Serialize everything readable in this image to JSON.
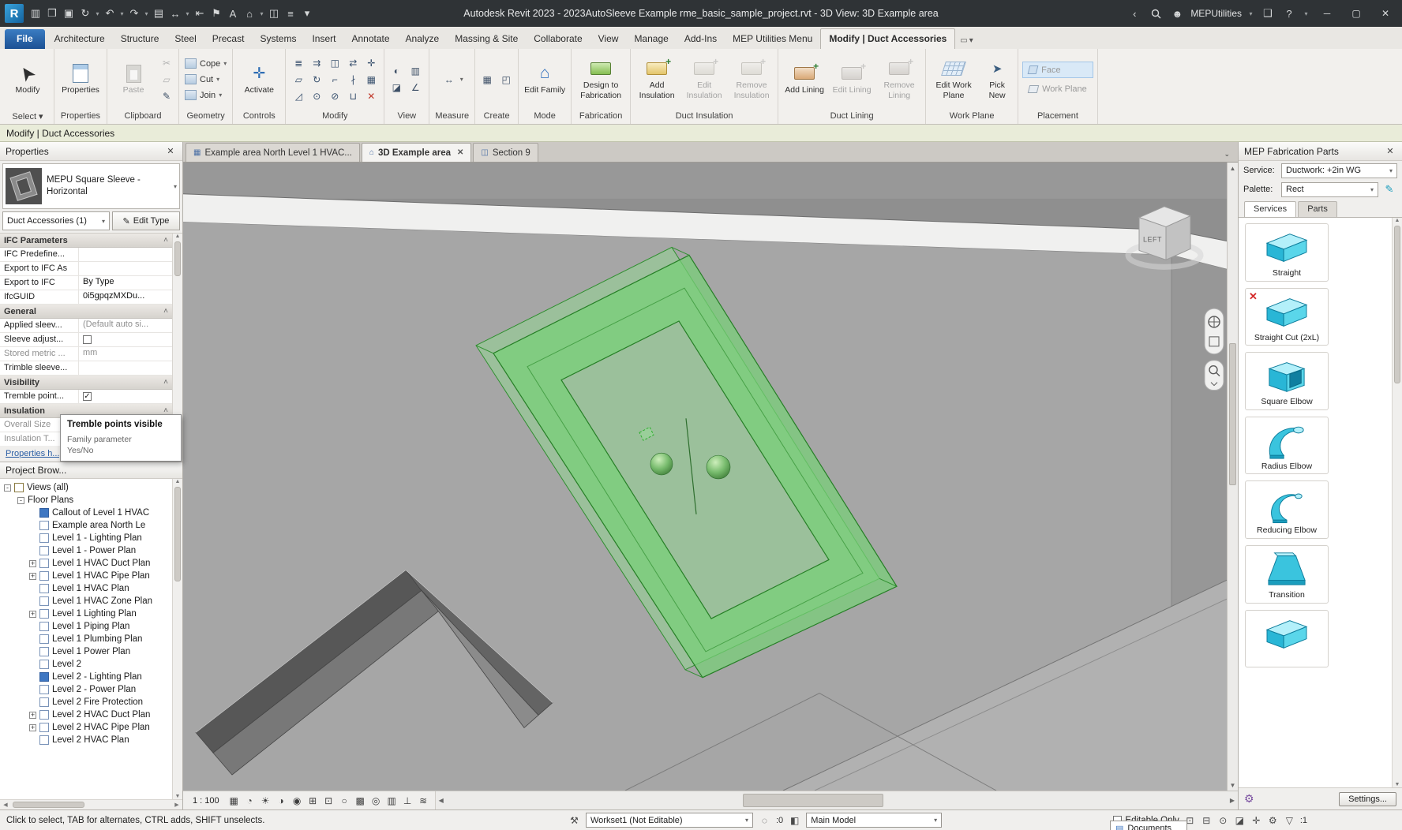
{
  "title_bar": {
    "title": "Autodesk Revit 2023 - 2023AutoSleeve Example rme_basic_sample_project.rvt - 3D View: 3D Example area",
    "account": "MEPUtilities",
    "qat": [
      {
        "name": "revit-logo",
        "glyph": "R",
        "logo": true
      },
      {
        "name": "file-tabs-icon",
        "glyph": "▥"
      },
      {
        "name": "open-icon",
        "glyph": "❒"
      },
      {
        "name": "save-icon",
        "glyph": "▣"
      },
      {
        "name": "sync-with-central-icon",
        "glyph": "↻",
        "caret": true
      },
      {
        "name": "undo-icon",
        "glyph": "↶",
        "caret": true
      },
      {
        "name": "redo-icon",
        "glyph": "↷",
        "caret": true
      },
      {
        "name": "print-icon",
        "glyph": "▤"
      },
      {
        "name": "measure-icon",
        "glyph": "↔",
        "caret": true
      },
      {
        "name": "aligned-dimension-icon",
        "glyph": "⇤"
      },
      {
        "name": "tag-by-category-icon",
        "glyph": "⚑"
      },
      {
        "name": "text-icon",
        "glyph": "A"
      },
      {
        "name": "default-3d-view-icon",
        "glyph": "⌂",
        "caret": true
      },
      {
        "name": "section-icon",
        "glyph": "◫"
      },
      {
        "name": "thin-lines-icon",
        "glyph": "≡"
      },
      {
        "name": "customize-qat-icon",
        "glyph": "▾"
      }
    ],
    "help_label": "?"
  },
  "ribbon_tabs": {
    "items": [
      {
        "label": "File",
        "file": true
      },
      {
        "label": "Architecture"
      },
      {
        "label": "Structure"
      },
      {
        "label": "Steel"
      },
      {
        "label": "Precast"
      },
      {
        "label": "Systems"
      },
      {
        "label": "Insert"
      },
      {
        "label": "Annotate"
      },
      {
        "label": "Analyze"
      },
      {
        "label": "Massing & Site"
      },
      {
        "label": "Collaborate"
      },
      {
        "label": "View"
      },
      {
        "label": "Manage"
      },
      {
        "label": "Add-Ins"
      },
      {
        "label": "MEP Utilities Menu"
      },
      {
        "label": "Modify | Duct Accessories",
        "active": true
      }
    ]
  },
  "ribbon": {
    "select": {
      "modify": "Modify",
      "panel": "Select ▾"
    },
    "properties": {
      "button": "Properties",
      "panel": "Properties"
    },
    "clipboard": {
      "paste": "Paste",
      "panel": "Clipboard",
      "small_icons": [
        {
          "name": "cut-icon",
          "glyph": "✂",
          "disabled": true
        },
        {
          "name": "copy-to-clipboard-icon",
          "glyph": "▱",
          "disabled": true
        },
        {
          "name": "match-type-properties-icon",
          "glyph": "✎"
        }
      ]
    },
    "geometry": {
      "rows": [
        "Cope",
        "Cut",
        "Join"
      ],
      "panel": "Geometry"
    },
    "controls": {
      "activate": "Activate",
      "panel": "Controls"
    },
    "modify": {
      "panel": "Modify",
      "icons": [
        {
          "name": "align-icon",
          "glyph": "≣"
        },
        {
          "name": "offset-icon",
          "glyph": "⇉"
        },
        {
          "name": "mirror-axis-icon",
          "glyph": "◫"
        },
        {
          "name": "mirror-pick-icon",
          "glyph": "⇄"
        },
        {
          "name": "move-icon",
          "glyph": "✛"
        },
        {
          "name": "copy-icon",
          "glyph": "▱"
        },
        {
          "name": "rotate-icon",
          "glyph": "↻"
        },
        {
          "name": "trim-extend-icon",
          "glyph": "⌐"
        },
        {
          "name": "split-icon",
          "glyph": "∤"
        },
        {
          "name": "array-icon",
          "glyph": "▦"
        },
        {
          "name": "scale-icon",
          "glyph": "◿"
        },
        {
          "name": "pin-icon",
          "glyph": "⊙"
        },
        {
          "name": "unpin-icon",
          "glyph": "⊘"
        },
        {
          "name": "join-geometry-icon",
          "glyph": "⊔"
        },
        {
          "name": "delete-icon",
          "glyph": "✕",
          "color": "#c0392b"
        }
      ]
    },
    "view": {
      "panel": "View",
      "icons": [
        {
          "name": "hide-elements-icon",
          "glyph": "◐"
        },
        {
          "name": "override-graphics-icon",
          "glyph": "▥"
        },
        {
          "name": "displace-elements-icon",
          "glyph": "◪"
        },
        {
          "name": "linework-icon",
          "glyph": "∠"
        }
      ]
    },
    "measure": {
      "panel": "Measure",
      "icons": [
        {
          "name": "measure-distance-icon",
          "glyph": "↔"
        }
      ]
    },
    "create": {
      "panel": "Create",
      "icons": [
        {
          "name": "create-parts-icon",
          "glyph": "▦"
        },
        {
          "name": "create-assembly-icon",
          "glyph": "◰"
        }
      ]
    },
    "mode": {
      "edit_family": "Edit Family",
      "panel": "Mode"
    },
    "fabrication": {
      "design_to_fab": "Design to Fabrication",
      "panel": "Fabrication"
    },
    "duct_insulation": {
      "add": "Add Insulation",
      "edit": "Edit Insulation",
      "remove": "Remove Insulation",
      "panel": "Duct Insulation"
    },
    "duct_lining": {
      "add": "Add Lining",
      "edit": "Edit Lining",
      "remove": "Remove Lining",
      "panel": "Duct Lining"
    },
    "work_plane": {
      "edit": "Edit Work Plane",
      "pick": "Pick New",
      "panel": "Work Plane"
    },
    "placement": {
      "face": "Face",
      "work_plane": "Work Plane",
      "panel": "Placement"
    }
  },
  "options_bar": {
    "text": "Modify | Duct Accessories"
  },
  "properties": {
    "header": "Properties",
    "type_name": "MEPU Square Sleeve - Horizontal",
    "selector": "Duct Accessories (1)",
    "edit_type": "Edit Type",
    "help_link": "Properties h...",
    "tooltip": {
      "title": "Tremble points visible",
      "line1": "Family parameter",
      "line2": "Yes/No"
    },
    "sections": [
      {
        "name": "IFC Parameters",
        "rows": [
          {
            "label": "IFC Predefine...",
            "value": "",
            "type": "text"
          },
          {
            "label": "Export to IFC As",
            "value": "",
            "type": "text"
          },
          {
            "label": "Export to IFC",
            "value": "By Type",
            "type": "text"
          },
          {
            "label": "IfcGUID",
            "value": "0i5gpqzMXDu...",
            "type": "text"
          }
        ]
      },
      {
        "name": "General",
        "rows": [
          {
            "label": "Applied sleev...",
            "value": "(Default auto si...",
            "type": "text",
            "value_muted": true
          },
          {
            "label": "Sleeve adjust...",
            "value": "",
            "type": "checkbox",
            "checked": false
          },
          {
            "label": "Stored metric ...",
            "value": "mm",
            "type": "text",
            "label_muted": true,
            "value_muted": true
          },
          {
            "label": "Trimble sleeve...",
            "value": "",
            "type": "text"
          }
        ]
      },
      {
        "name": "Visibility",
        "rows": [
          {
            "label": "Tremble point...",
            "value": "",
            "type": "checkbox",
            "checked": true
          }
        ]
      },
      {
        "name": "Insulation",
        "rows": [
          {
            "label": "Overall Size",
            "value": "",
            "type": "text",
            "label_muted": true
          },
          {
            "label": "Insulation T...",
            "value": "",
            "type": "text",
            "label_muted": true
          }
        ]
      }
    ]
  },
  "project_browser": {
    "header": "Project Brow...",
    "root_label": "Views (all)",
    "group_label": "Floor Plans",
    "items": [
      {
        "label": "Callout of Level 1 HVAC",
        "highlight": true
      },
      {
        "label": "Example area North Le"
      },
      {
        "label": "Level 1 - Lighting Plan"
      },
      {
        "label": "Level 1 - Power Plan"
      },
      {
        "label": "Level 1 HVAC Duct Plan",
        "expandable": true
      },
      {
        "label": "Level 1 HVAC Pipe Plan",
        "expandable": true
      },
      {
        "label": "Level 1 HVAC Plan"
      },
      {
        "label": "Level 1 HVAC Zone Plan"
      },
      {
        "label": "Level 1 Lighting Plan",
        "expandable": true
      },
      {
        "label": "Level 1 Piping Plan"
      },
      {
        "label": "Level 1 Plumbing Plan"
      },
      {
        "label": "Level 1 Power Plan"
      },
      {
        "label": "Level 2"
      },
      {
        "label": "Level 2 - Lighting Plan",
        "highlight": true
      },
      {
        "label": "Level 2 - Power Plan"
      },
      {
        "label": "Level 2 Fire Protection"
      },
      {
        "label": "Level 2 HVAC Duct Plan",
        "expandable": true
      },
      {
        "label": "Level 2 HVAC Pipe Plan",
        "expandable": true
      },
      {
        "label": "Level 2 HVAC Plan"
      }
    ]
  },
  "viewport": {
    "tabs": [
      {
        "label": "Example area North Level 1 HVAC...",
        "icon": "plan-view-icon"
      },
      {
        "label": "3D Example area",
        "icon": "3d-view-icon",
        "active": true,
        "closable": true
      },
      {
        "label": "Section 9",
        "icon": "section-view-icon"
      }
    ],
    "view_cube_label": "LEFT",
    "scale_label": "1 : 100",
    "control_icons": [
      {
        "name": "detail-level-icon",
        "glyph": "▦"
      },
      {
        "name": "visual-style-icon",
        "glyph": "◔"
      },
      {
        "name": "sun-path-icon",
        "glyph": "☀"
      },
      {
        "name": "shadows-icon",
        "glyph": "◑"
      },
      {
        "name": "render-icon",
        "glyph": "◉"
      },
      {
        "name": "crop-view-icon",
        "glyph": "⊞"
      },
      {
        "name": "show-crop-icon",
        "glyph": "⊡"
      },
      {
        "name": "unlocked-view-icon",
        "glyph": "○"
      },
      {
        "name": "temporary-hide-icon",
        "glyph": "▩"
      },
      {
        "name": "reveal-hidden-icon",
        "glyph": "◎"
      },
      {
        "name": "temporary-view-properties-icon",
        "glyph": "▥"
      },
      {
        "name": "show-constraints-icon",
        "glyph": "⊥"
      },
      {
        "name": "worksharing-display-icon",
        "glyph": "≋"
      }
    ]
  },
  "mep_panel": {
    "header": "MEP Fabrication Parts",
    "service_label": "Service:",
    "service_value": "Ductwork: +2in WG",
    "palette_label": "Palette:",
    "palette_value": "Rect",
    "tabs": [
      "Services",
      "Parts"
    ],
    "settings_button": "Settings...",
    "parts": [
      {
        "name": "Straight",
        "icon": "straight-duct-icon"
      },
      {
        "name": "Straight Cut (2xL)",
        "icon": "straight-duct-icon",
        "error": true
      },
      {
        "name": "Square Elbow",
        "icon": "square-elbow-icon"
      },
      {
        "name": "Radius Elbow",
        "icon": "radius-elbow-icon"
      },
      {
        "name": "Reducing Elbow",
        "icon": "reducing-elbow-icon"
      },
      {
        "name": "Transition",
        "icon": "transition-icon"
      },
      {
        "name": "",
        "icon": "straight-duct-icon",
        "partial": true
      }
    ]
  },
  "status_bar": {
    "hint": "Click to select, TAB for alternates, CTRL adds, SHIFT unselects.",
    "workset_value": "Workset1 (Not Editable)",
    "inactive_count": ":0",
    "design_option_value": "Main Model",
    "editable_only_label": "Editable Only",
    "selection_count": ":1",
    "right_icons": [
      {
        "name": "select-links-icon",
        "glyph": "⊡"
      },
      {
        "name": "select-underlay-icon",
        "glyph": "⊟"
      },
      {
        "name": "select-pinned-icon",
        "glyph": "⊙"
      },
      {
        "name": "select-by-face-icon",
        "glyph": "◪"
      },
      {
        "name": "drag-on-selection-icon",
        "glyph": "✛"
      },
      {
        "name": "background-processes-icon",
        "glyph": "⚙"
      },
      {
        "name": "selection-filter-icon",
        "glyph": "▽"
      }
    ]
  },
  "documents_tab": {
    "label": "Documents"
  }
}
